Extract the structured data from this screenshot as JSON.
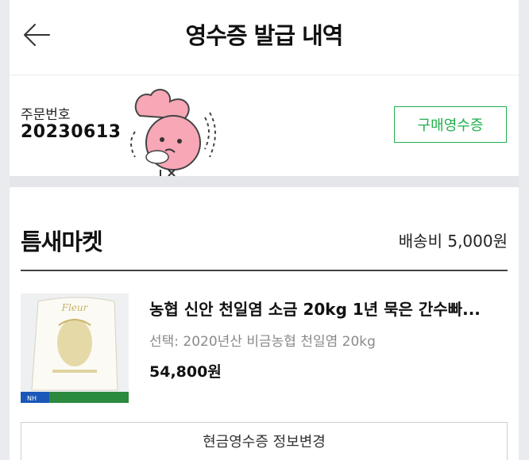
{
  "header": {
    "title": "영수증 발급 내역",
    "back_icon": "arrow-left-icon"
  },
  "order": {
    "label": "주문번호",
    "number": "20230613",
    "receipt_button": "구매영수증"
  },
  "shop": {
    "name": "틈새마켓",
    "shipping": "배송비 5,000원"
  },
  "product": {
    "name": "농협 신안 천일염 소금 20kg 1년 묵은 간수빠...",
    "option": "선택: 2020년산 비금농협 천일염 20kg",
    "price": "54,800원"
  },
  "cash_receipt_button": "현금영수증 정보변경",
  "colors": {
    "accent": "#1fb04b",
    "divider": "#444444",
    "separator_bg": "#e4e6ea"
  }
}
